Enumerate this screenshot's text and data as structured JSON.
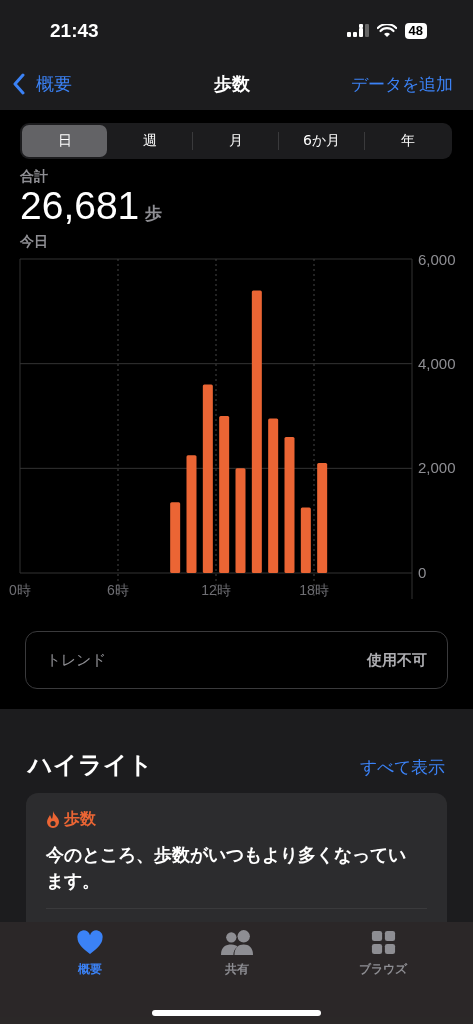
{
  "status_bar": {
    "time": "21:43",
    "battery": "48"
  },
  "nav": {
    "back": "概要",
    "title": "歩数",
    "action": "データを追加"
  },
  "segments": [
    {
      "label": "日",
      "selected": true
    },
    {
      "label": "週",
      "selected": false
    },
    {
      "label": "月",
      "selected": false
    },
    {
      "label": "6か月",
      "selected": false
    },
    {
      "label": "年",
      "selected": false
    }
  ],
  "summary": {
    "label": "合計",
    "value": "26,681",
    "unit": "歩",
    "period": "今日"
  },
  "chart_data": {
    "type": "bar",
    "x": [
      9.5,
      10.5,
      11.5,
      12.5,
      13.5,
      14.5,
      15.5,
      16.5,
      17.5,
      18.5
    ],
    "series": [
      {
        "color": "#eb6534",
        "values": [
          1350,
          2250,
          3600,
          3000,
          2000,
          5400,
          2950,
          2600,
          1250,
          2100
        ]
      }
    ],
    "xlim": [
      0,
      24
    ],
    "grid": true,
    "ylim": [
      0,
      6000
    ],
    "yticks": [
      {
        "value": 0,
        "label": "0"
      },
      {
        "value": 2000,
        "label": "2,000"
      },
      {
        "value": 4000,
        "label": "4,000"
      },
      {
        "value": 6000,
        "label": "6,000"
      }
    ],
    "xticks": [
      {
        "value": 0,
        "label": "0時"
      },
      {
        "value": 6,
        "label": "6時"
      },
      {
        "value": 12,
        "label": "12時"
      },
      {
        "value": 18,
        "label": "18時"
      }
    ]
  },
  "trend": {
    "label": "トレンド",
    "value": "使用不可"
  },
  "highlights": {
    "title": "ハイライト",
    "link": "すべて表示",
    "cards": [
      {
        "category": "歩数",
        "text": "今のところ、歩数がいつもより多くなっています。"
      }
    ]
  },
  "tab_bar": [
    {
      "label": "概要",
      "kind": "heart",
      "selected": true
    },
    {
      "label": "共有",
      "kind": "people",
      "selected": false
    },
    {
      "label": "ブラウズ",
      "kind": "grid",
      "selected": false
    }
  ]
}
